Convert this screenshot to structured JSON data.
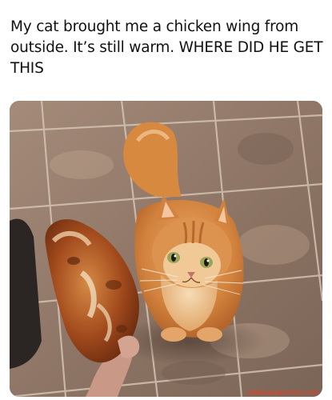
{
  "post": {
    "caption_lines": [
      "My cat brought me a chicken wing from",
      "outside. It’s still warm. WHERE DID HE GET",
      "THIS"
    ],
    "photo": {
      "subject": "orange-long-haired-cat",
      "held_item": "fried-chicken-wing",
      "floor": "marble-tile"
    },
    "watermark": "AMERICASBESTPICS.COM"
  },
  "colors": {
    "fur": "#d98a45",
    "fur_light": "#f1c995",
    "chicken": "#a24c1e",
    "floor": "#9c8372",
    "watermark": "#e0402a"
  }
}
